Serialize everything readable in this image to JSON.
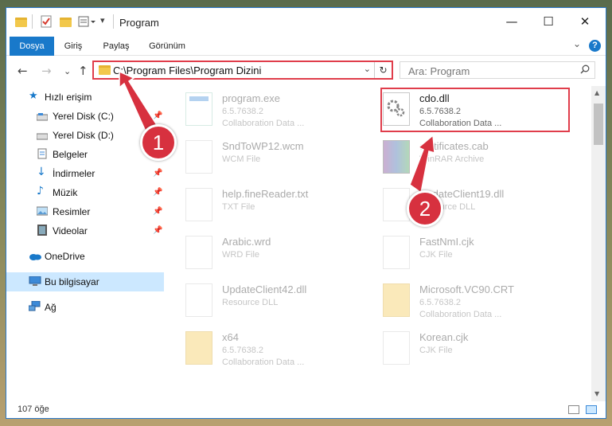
{
  "window": {
    "title": "Program",
    "controls": {
      "minimize": "—",
      "maximize": "☐",
      "close": "✕"
    }
  },
  "ribbon": {
    "tabs": [
      {
        "label": "Dosya"
      },
      {
        "label": "Giriş"
      },
      {
        "label": "Paylaş"
      },
      {
        "label": "Görünüm"
      }
    ],
    "expand_icon": "⌄",
    "help_icon": "?"
  },
  "nav": {
    "back": "←",
    "forward": "→",
    "recent": "⌄",
    "up": "↑"
  },
  "address": {
    "path": "C:\\Program Files\\Program Dizini",
    "dropdown": "⌄",
    "refresh": "↻"
  },
  "search": {
    "placeholder": "Ara: Program"
  },
  "sidebar": {
    "items": [
      {
        "label": "Hızlı erişim",
        "icon": "star-icon"
      },
      {
        "label": "Yerel Disk (C:)",
        "icon": "drive-icon"
      },
      {
        "label": "Yerel Disk (D:)",
        "icon": "drive-icon"
      },
      {
        "label": "Belgeler",
        "icon": "documents-icon"
      },
      {
        "label": "İndirmeler",
        "icon": "download-icon"
      },
      {
        "label": "Müzik",
        "icon": "music-icon"
      },
      {
        "label": "Resimler",
        "icon": "pictures-icon"
      },
      {
        "label": "Videolar",
        "icon": "video-icon"
      },
      {
        "label": "OneDrive",
        "icon": "cloud-icon"
      },
      {
        "label": "Bu bilgisayar",
        "icon": "computer-icon"
      },
      {
        "label": "Ağ",
        "icon": "network-icon"
      }
    ]
  },
  "files": [
    {
      "name": "program.exe",
      "line2": "6.5.7638.2",
      "line3": "Collaboration Data ...",
      "highlight": false
    },
    {
      "name": "cdo.dll",
      "line2": "6.5.7638.2",
      "line3": "Collaboration Data ...",
      "highlight": true
    },
    {
      "name": "SndToWP12.wcm",
      "line2": "WCM File",
      "line3": "",
      "highlight": false
    },
    {
      "name": "certificates.cab",
      "line2": "WinRAR Archive",
      "line3": "",
      "highlight": false
    },
    {
      "name": "help.fineReader.txt",
      "line2": "TXT File",
      "line3": "",
      "highlight": false
    },
    {
      "name": "UpdateClient19.dll",
      "line2": "Resource DLL",
      "line3": "",
      "highlight": false
    },
    {
      "name": "Arabic.wrd",
      "line2": "WRD File",
      "line3": "",
      "highlight": false
    },
    {
      "name": "FastNmI.cjk",
      "line2": "CJK File",
      "line3": "",
      "highlight": false
    },
    {
      "name": "UpdateClient42.dll",
      "line2": "Resource DLL",
      "line3": "",
      "highlight": false
    },
    {
      "name": "Microsoft.VC90.CRT",
      "line2": "6.5.7638.2",
      "line3": "Collaboration Data ...",
      "highlight": false
    },
    {
      "name": "x64",
      "line2": "6.5.7638.2",
      "line3": "Collaboration Data ...",
      "highlight": false
    },
    {
      "name": "Korean.cjk",
      "line2": "CJK File",
      "line3": "",
      "highlight": false
    }
  ],
  "status": {
    "count": "107 öğe"
  },
  "annotations": {
    "step1": "1",
    "step2": "2",
    "color": "#d7313f"
  }
}
